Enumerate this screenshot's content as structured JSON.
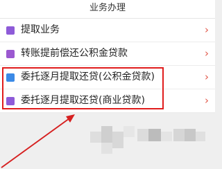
{
  "header": {
    "title": "业务办理"
  },
  "menu": {
    "items": [
      {
        "label": "提取业务",
        "icon": "withdraw-icon",
        "icon_color": "#8e5bd8"
      },
      {
        "label": "转账提前偿还公积金贷款",
        "icon": "transfer-icon",
        "icon_color": "#9b59d0"
      },
      {
        "label": "委托逐月提取还贷(公积金贷款)",
        "icon": "calendar-icon",
        "icon_color": "#3b8ae6"
      },
      {
        "label": "委托逐月提取还贷(商业贷款)",
        "icon": "calendar-icon",
        "icon_color": "#8e5bd8"
      }
    ],
    "chevron": "›"
  },
  "colors": {
    "highlight": "#e01c1c",
    "arrow": "#d62020",
    "chevron": "#e2584a"
  }
}
